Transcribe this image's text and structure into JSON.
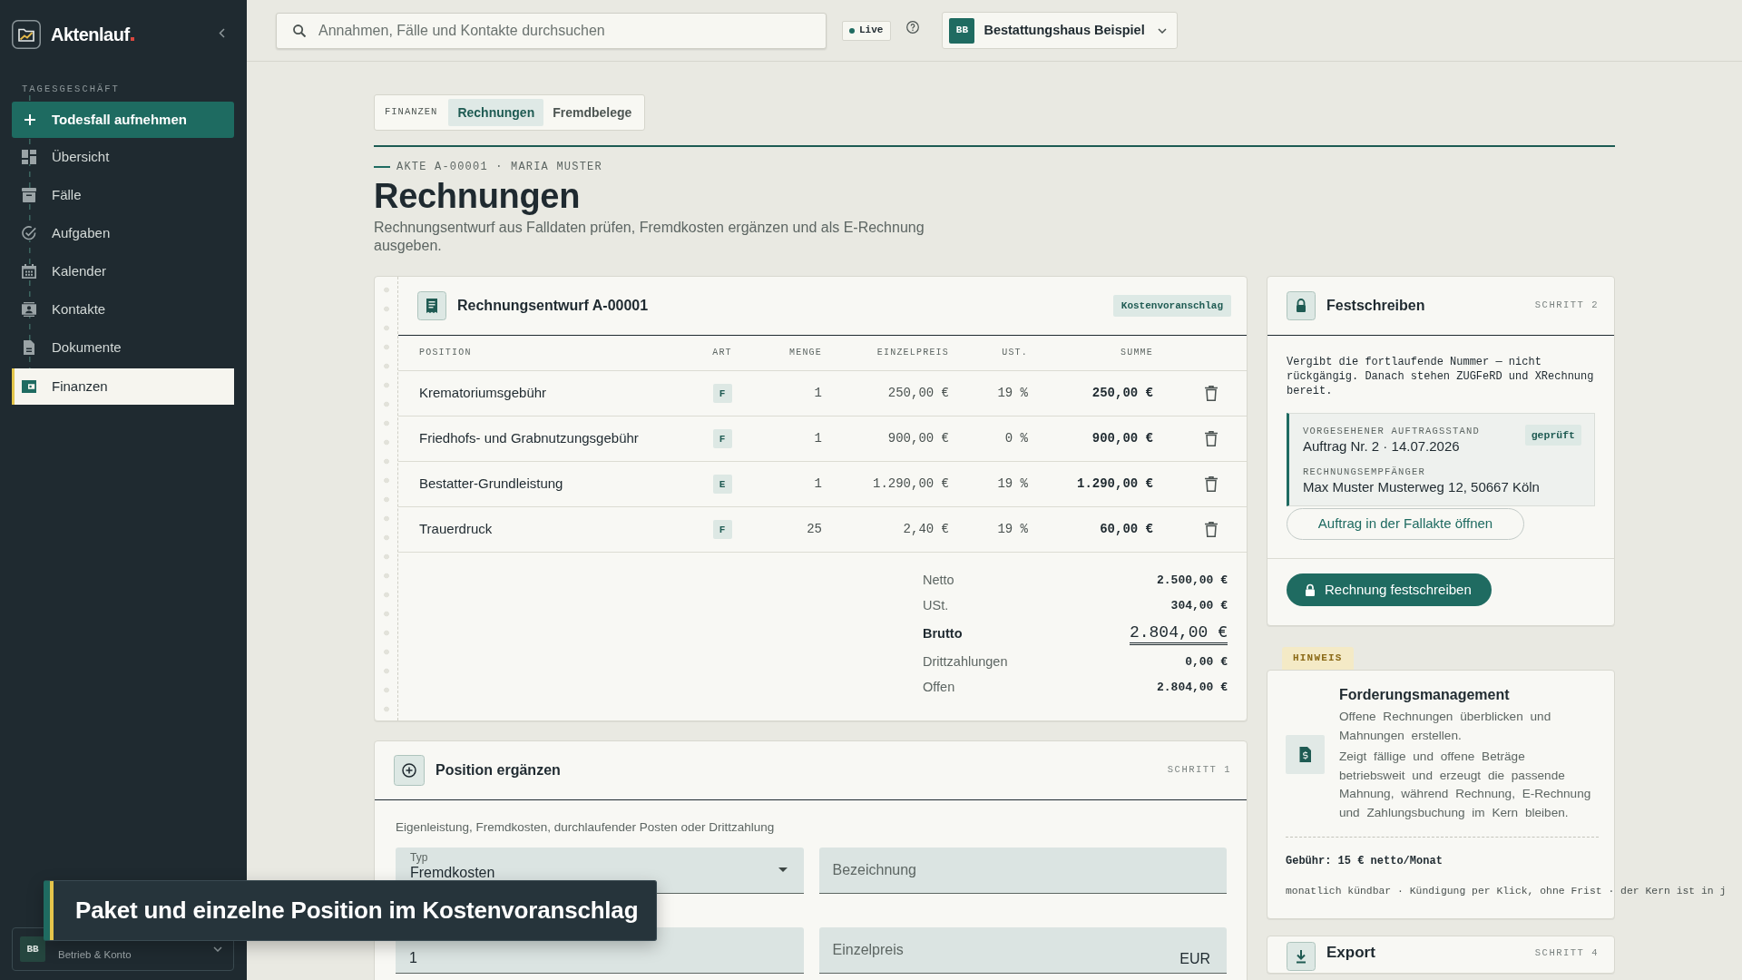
{
  "sidebar": {
    "brand": "Aktenlauf",
    "section_label": "TAGESGESCHÄFT",
    "primary_action": "Todesfall aufnehmen",
    "items": [
      {
        "label": "Übersicht",
        "selected": false
      },
      {
        "label": "Fälle",
        "selected": false
      },
      {
        "label": "Aufgaben",
        "selected": false
      },
      {
        "label": "Kalender",
        "selected": false
      },
      {
        "label": "Kontakte",
        "selected": false
      },
      {
        "label": "Dokumente",
        "selected": false
      },
      {
        "label": "Finanzen",
        "selected": true
      }
    ],
    "account": {
      "avatar": "BB",
      "subtitle": "Betrieb & Konto"
    }
  },
  "top_bar": {
    "search": {
      "placeholder": "Annahmen, Fälle und Kontakte durchsuchen"
    },
    "live_badge": "Live",
    "organization": {
      "avatar": "BB",
      "name": "Bestattungshaus Beispiel"
    }
  },
  "section_tabs": {
    "label": "FINANZEN",
    "items": [
      {
        "label": "Rechnungen",
        "selected": true
      },
      {
        "label": "Fremdbelege",
        "selected": false
      }
    ]
  },
  "page_header": {
    "breadcrumb": "AKTE A-00001 · MARIA MUSTER",
    "title": "Rechnungen",
    "subtitle": "Rechnungsentwurf aus Falldaten prüfen, Fremdkosten ergänzen und als E-Rechnung ausgeben."
  },
  "invoice_draft": {
    "title": "Rechnungsentwurf A-00001",
    "badge": "Kostenvoranschlag",
    "table": {
      "columns": [
        "POSITION",
        "ART",
        "MENGE",
        "EINZELPREIS",
        "UST.",
        "SUMME"
      ],
      "rows": [
        {
          "position": "Krematoriumsgebühr",
          "art": "F",
          "menge": "1",
          "einzelpreis": "250,00 €",
          "ust": "19 %",
          "summe": "250,00 €"
        },
        {
          "position": "Friedhofs- und Grabnutzungsgebühr",
          "art": "F",
          "menge": "1",
          "einzelpreis": "900,00 €",
          "ust": "0 %",
          "summe": "900,00 €"
        },
        {
          "position": "Bestatter-Grundleistung",
          "art": "E",
          "menge": "1",
          "einzelpreis": "1.290,00 €",
          "ust": "19 %",
          "summe": "1.290,00 €"
        },
        {
          "position": "Trauerdruck",
          "art": "F",
          "menge": "25",
          "einzelpreis": "2,40 €",
          "ust": "19 %",
          "summe": "60,00 €"
        }
      ]
    },
    "totals": [
      {
        "label": "Netto",
        "value": "2.500,00 €",
        "kind": "line"
      },
      {
        "label": "USt.",
        "value": "304,00 €",
        "kind": "line"
      },
      {
        "label": "Brutto",
        "value": "2.804,00 €",
        "kind": "grand"
      },
      {
        "label": "Drittzahlungen",
        "value": "0,00 €",
        "kind": "line"
      },
      {
        "label": "Offen",
        "value": "2.804,00 €",
        "kind": "line"
      }
    ]
  },
  "position_form": {
    "title": "Position ergänzen",
    "step": "SCHRITT 1",
    "hint": "Eigenleistung, Fremdkosten, durchlaufender Posten oder Drittzahlung",
    "fields": [
      {
        "kind": "select",
        "label": "Typ",
        "value": "Fremdkosten"
      },
      {
        "kind": "text",
        "placeholder": "Bezeichnung"
      },
      {
        "kind": "text",
        "value": "1"
      },
      {
        "kind": "currency",
        "placeholder": "Einzelpreis",
        "suffix": "EUR"
      }
    ]
  },
  "finalize": {
    "title": "Festschreiben",
    "step": "SCHRITT 2",
    "note": "Vergibt die fortlaufende Nummer — nicht rückgängig. Danach stehen ZUGFeRD und XRechnung bereit.",
    "order": {
      "label": "VORGESEHENER AUFTRAGSSTAND",
      "value": "Auftrag Nr. 2 · 14.07.2026",
      "badge": "geprüft"
    },
    "recipient": {
      "label": "RECHNUNGSEMPFÄNGER",
      "value": "Max Muster Musterweg 12, 50667 Köln"
    },
    "link_button": "Auftrag in der Fallakte öffnen",
    "primary_button": "Rechnung festschreiben"
  },
  "notice": {
    "tag": "HINWEIS",
    "title": "Forderungsmanagement",
    "lead": "Offene Rechnungen überblicken und Mahnungen erstellen.",
    "body": "Zeigt fällige und offene Beträge betriebsweit und erzeugt die passende Mahnung, während Rechnung, E-Rechnung und Zahlungsbuchung im Kern bleiben.",
    "fee": "Gebühr: 15 € netto/Monat",
    "terms": "monatlich kündbar · Kündigung per Klick, ohne Frist · der Kern ist in j"
  },
  "export": {
    "title": "Export",
    "step": "SCHRITT 4"
  },
  "toast": {
    "message": "Paket und einzelne Position im Kostenvoranschlag"
  }
}
